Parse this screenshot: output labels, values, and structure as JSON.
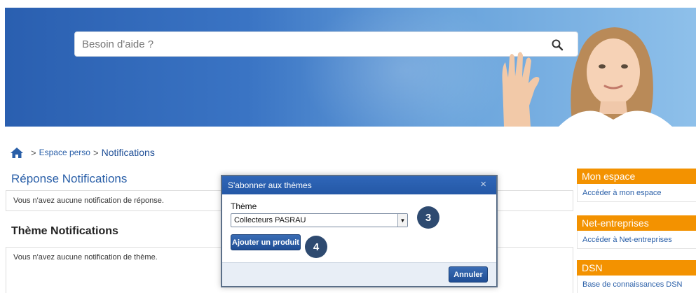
{
  "header": {
    "search": {
      "placeholder": "Besoin d'aide ?",
      "icon": "search-icon"
    }
  },
  "breadcrumb": {
    "home_icon": "home-icon",
    "separator": ">",
    "items": [
      "Espace perso",
      "Notifications"
    ]
  },
  "main": {
    "reponse_title": "Réponse Notifications",
    "reponse_empty": "Vous n'avez aucune notification de réponse.",
    "theme_title": "Thème Notifications",
    "theme_empty": "Vous n'avez aucune notification de thème."
  },
  "sidebar": {
    "panels": [
      {
        "title": "Mon espace",
        "link": "Accéder à mon espace"
      },
      {
        "title": "Net-entreprises",
        "link": "Accéder à Net-entreprises"
      },
      {
        "title": "DSN",
        "link": "Base de connaissances DSN"
      }
    ]
  },
  "modal": {
    "title": "S'abonner aux thèmes",
    "close": "×",
    "field_label": "Thème",
    "selected_value": "Collecteurs PASRAU",
    "add_button": "Ajouter un produit",
    "cancel_button": "Annuler"
  },
  "annotations": {
    "step3": "3",
    "step4": "4"
  },
  "colors": {
    "brand_blue": "#2a5fa8",
    "accent_orange": "#f39200",
    "badge": "#2e4a70"
  }
}
